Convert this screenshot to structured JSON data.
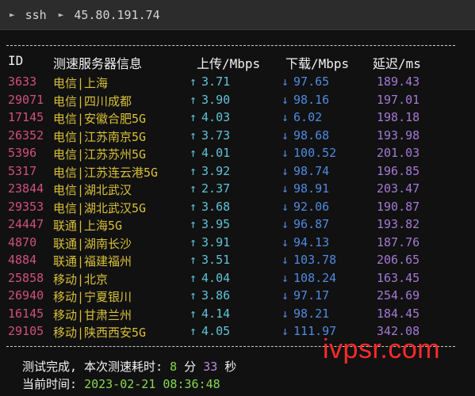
{
  "titlebar": {
    "segments": [
      "ssh",
      "45.80.191.74"
    ]
  },
  "header": {
    "id": "ID",
    "server": "测速服务器信息",
    "upload": "上传/Mbps",
    "download": "下载/Mbps",
    "latency": "延迟/ms"
  },
  "icons": {
    "up": "↑",
    "down": "↓"
  },
  "rows": [
    {
      "id": "3633",
      "server": "电信|上海",
      "up": "3.71",
      "down": "97.65",
      "lat": "189.43"
    },
    {
      "id": "29071",
      "server": "电信|四川成都",
      "up": "3.90",
      "down": "98.16",
      "lat": "197.01"
    },
    {
      "id": "17145",
      "server": "电信|安徽合肥5G",
      "up": "4.03",
      "down": "6.02",
      "lat": "198.18"
    },
    {
      "id": "26352",
      "server": "电信|江苏南京5G",
      "up": "3.73",
      "down": "98.68",
      "lat": "193.98"
    },
    {
      "id": "5396",
      "server": "电信|江苏苏州5G",
      "up": "4.01",
      "down": "100.52",
      "lat": "201.03"
    },
    {
      "id": "5317",
      "server": "电信|江苏连云港5G",
      "up": "3.92",
      "down": "98.74",
      "lat": "196.85"
    },
    {
      "id": "23844",
      "server": "电信|湖北武汉",
      "up": "2.37",
      "down": "98.91",
      "lat": "203.47"
    },
    {
      "id": "29353",
      "server": "电信|湖北武汉5G",
      "up": "3.68",
      "down": "92.06",
      "lat": "190.87"
    },
    {
      "id": "24447",
      "server": "联通|上海5G",
      "up": "3.95",
      "down": "96.87",
      "lat": "193.82"
    },
    {
      "id": "4870",
      "server": "联通|湖南长沙",
      "up": "3.91",
      "down": "94.13",
      "lat": "187.76"
    },
    {
      "id": "4884",
      "server": "联通|福建福州",
      "up": "3.51",
      "down": "103.78",
      "lat": "206.65"
    },
    {
      "id": "25858",
      "server": "移动|北京",
      "up": "4.04",
      "down": "108.24",
      "lat": "163.45"
    },
    {
      "id": "26940",
      "server": "移动|宁夏银川",
      "up": "3.86",
      "down": "97.17",
      "lat": "254.69"
    },
    {
      "id": "16145",
      "server": "移动|甘肃兰州",
      "up": "4.14",
      "down": "98.21",
      "lat": "184.45"
    },
    {
      "id": "29105",
      "server": "移动|陕西西安5G",
      "up": "4.05",
      "down": "111.97",
      "lat": "342.08"
    }
  ],
  "footer": {
    "done_prefix": "测试完成, 本次测速耗时: ",
    "minutes": "8",
    "min_unit": " 分 ",
    "seconds": "33",
    "sec_unit": " 秒",
    "time_label": "当前时间: ",
    "time_value": "2023-02-21 08:36:48"
  },
  "watermark": "ivpsr.com",
  "colors": {
    "id": "#d0507f",
    "server": "#d8c03a",
    "upload": "#5fc4d8",
    "download": "#4f8be0",
    "latency": "#a37ad4",
    "watermark": "#ff2a2a"
  }
}
